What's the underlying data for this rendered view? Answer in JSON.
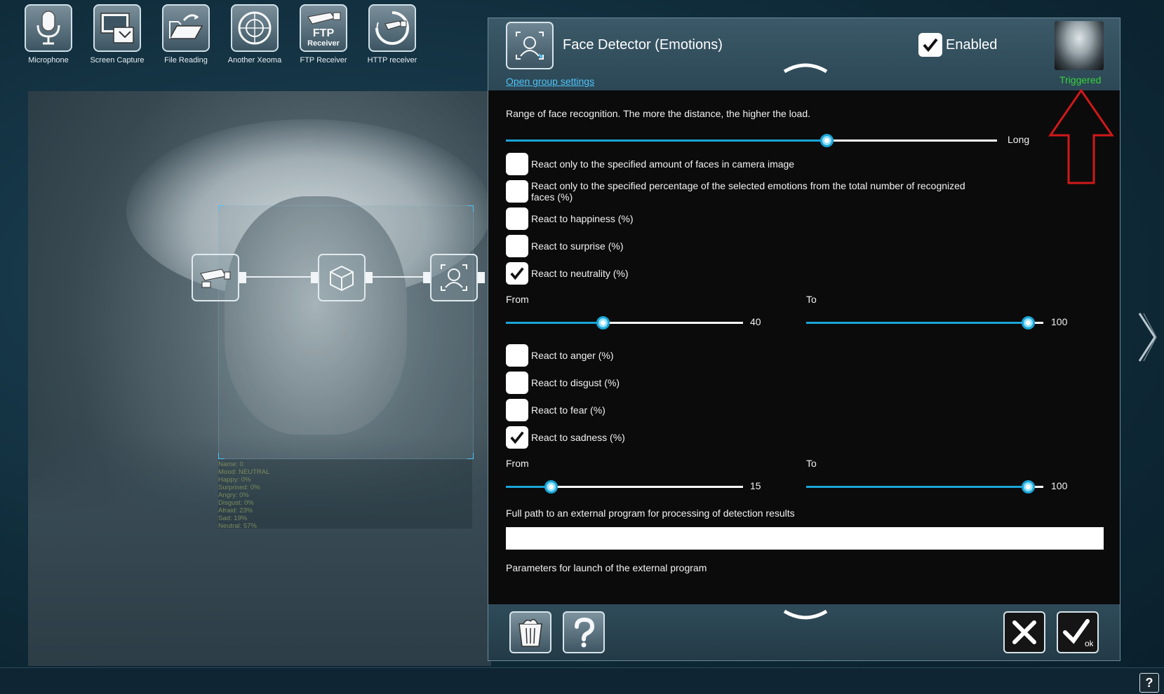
{
  "toolbar": {
    "items": [
      {
        "label": "Microphone",
        "icon": "microphone-icon"
      },
      {
        "label": "Screen Capture",
        "icon": "screen-capture-icon"
      },
      {
        "label": "File Reading",
        "icon": "file-reading-icon"
      },
      {
        "label": "Another Xeoma",
        "icon": "another-xeoma-icon"
      },
      {
        "label": "FTP Receiver",
        "icon": "ftp-receiver-icon"
      },
      {
        "label": "HTTP receiver",
        "icon": "http-receiver-icon"
      }
    ],
    "ftp_icon_text": "FTP",
    "ftp_icon_subtext": "Receiver"
  },
  "face_overlay": {
    "stats": [
      "Name: 0",
      "Mood: NEUTRAL",
      "Happy: 0%",
      "Surprised: 0%",
      "Angry: 0%",
      "Disgust: 0%",
      "Afraid: 23%",
      "Sad: 19%",
      "Neutral: 57%"
    ]
  },
  "dialog": {
    "title": "Face Detector (Emotions)",
    "group_link": "Open group settings",
    "enabled_label": "Enabled",
    "enabled": true,
    "triggered_label": "Triggered",
    "range_text": "Range of face recognition. The more the distance, the higher the load.",
    "range_value_label": "Long",
    "range_value": 0.66,
    "options": [
      {
        "label": "React only to the specified amount of faces in camera image",
        "checked": false
      },
      {
        "label": "React only to the specified percentage of the selected emotions from the total number of recognized faces (%)",
        "checked": false
      },
      {
        "label": "React to happiness (%)",
        "checked": false
      },
      {
        "label": "React to surprise (%)",
        "checked": false
      },
      {
        "label": "React to neutrality (%)",
        "checked": true
      },
      {
        "label": "React to anger (%)",
        "checked": false
      },
      {
        "label": "React to disgust (%)",
        "checked": false
      },
      {
        "label": "React to fear (%)",
        "checked": false
      },
      {
        "label": "React to sadness (%)",
        "checked": true
      }
    ],
    "neutrality_range": {
      "from_label": "From",
      "to_label": "To",
      "from": 40,
      "to": 100
    },
    "sadness_range": {
      "from_label": "From",
      "to_label": "To",
      "from": 15,
      "to": 100
    },
    "external_program_label": "Full path to an external program for processing of detection results",
    "external_program_value": "",
    "parameters_label": "Parameters for launch of the external program",
    "ok_label": "ok"
  },
  "help_label": "?",
  "colors": {
    "accent": "#1aa5d6",
    "triggered": "#37d23a",
    "link": "#4fc3f7",
    "annotation": "#d01818"
  }
}
